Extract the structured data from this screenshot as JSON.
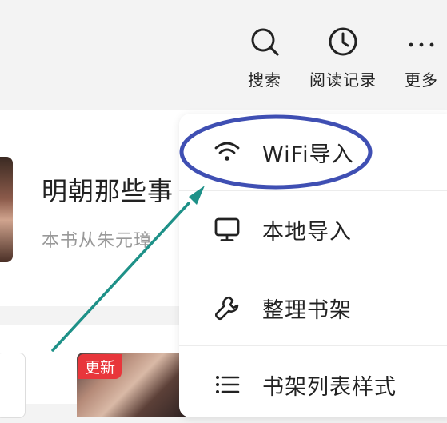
{
  "toolbar": {
    "search_label": "搜索",
    "history_label": "阅读记录",
    "more_label": "更多"
  },
  "shelf": {
    "book_title": "明朝那些事",
    "book_desc": "本书从朱元璋",
    "update_badge": "更新"
  },
  "menu": {
    "items": [
      {
        "label": "WiFi导入",
        "icon": "wifi-icon"
      },
      {
        "label": "本地导入",
        "icon": "monitor-icon"
      },
      {
        "label": "整理书架",
        "icon": "wrench-icon"
      },
      {
        "label": "书架列表样式",
        "icon": "list-icon"
      }
    ]
  },
  "annotation": {
    "highlight_color": "#3f4fb3",
    "arrow_color": "#1e9188"
  }
}
